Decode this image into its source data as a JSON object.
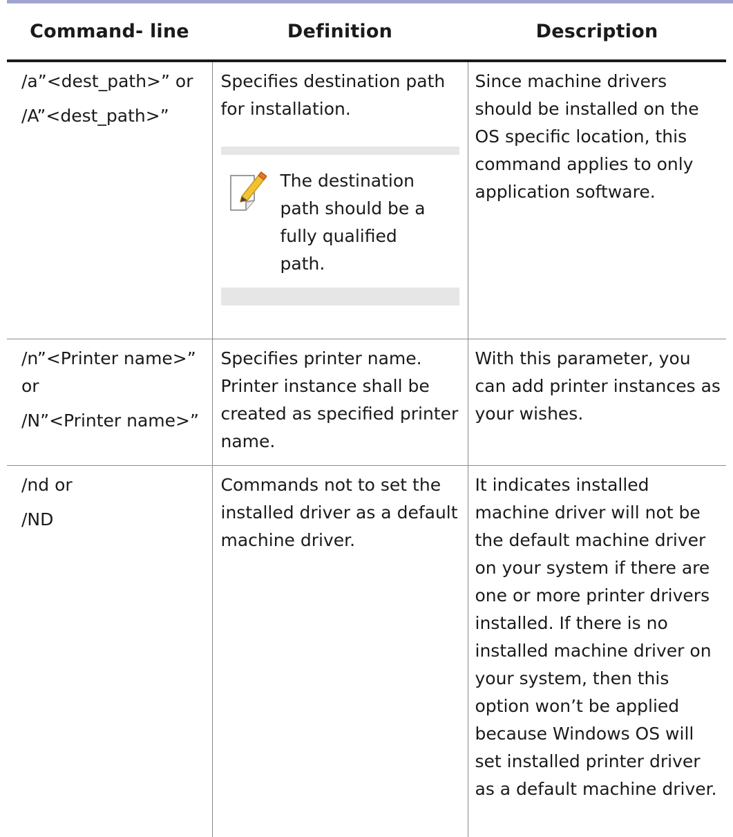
{
  "table": {
    "headers": [
      "Command- line",
      "Definition",
      "Description"
    ],
    "rows": [
      {
        "command": [
          "/a”<dest_path>” or",
          "/A”<dest_path>”"
        ],
        "definition": "Specifies destination path for installation.",
        "note": {
          "icon": "note-pencil-icon",
          "text": "The destination path should be a fully qualified path."
        },
        "description": "Since machine drivers should be installed on the OS specific location, this command applies to only application software."
      },
      {
        "command": [
          "/n”<Printer name>” or",
          "/N”<Printer name>”"
        ],
        "definition": "Specifies printer name. Printer instance shall be created as specified printer name.",
        "description": "With this parameter, you can add printer instances as your wishes."
      },
      {
        "command": [
          "/nd or",
          "/ND"
        ],
        "definition": "Commands not to set the installed driver as a default machine driver.",
        "description": "It indicates installed machine driver will not be the default machine driver on your system if there are one or more printer drivers installed. If there is no installed machine driver on your system, then this option won’t be applied because Windows OS will set installed printer driver as a default machine driver."
      }
    ]
  }
}
